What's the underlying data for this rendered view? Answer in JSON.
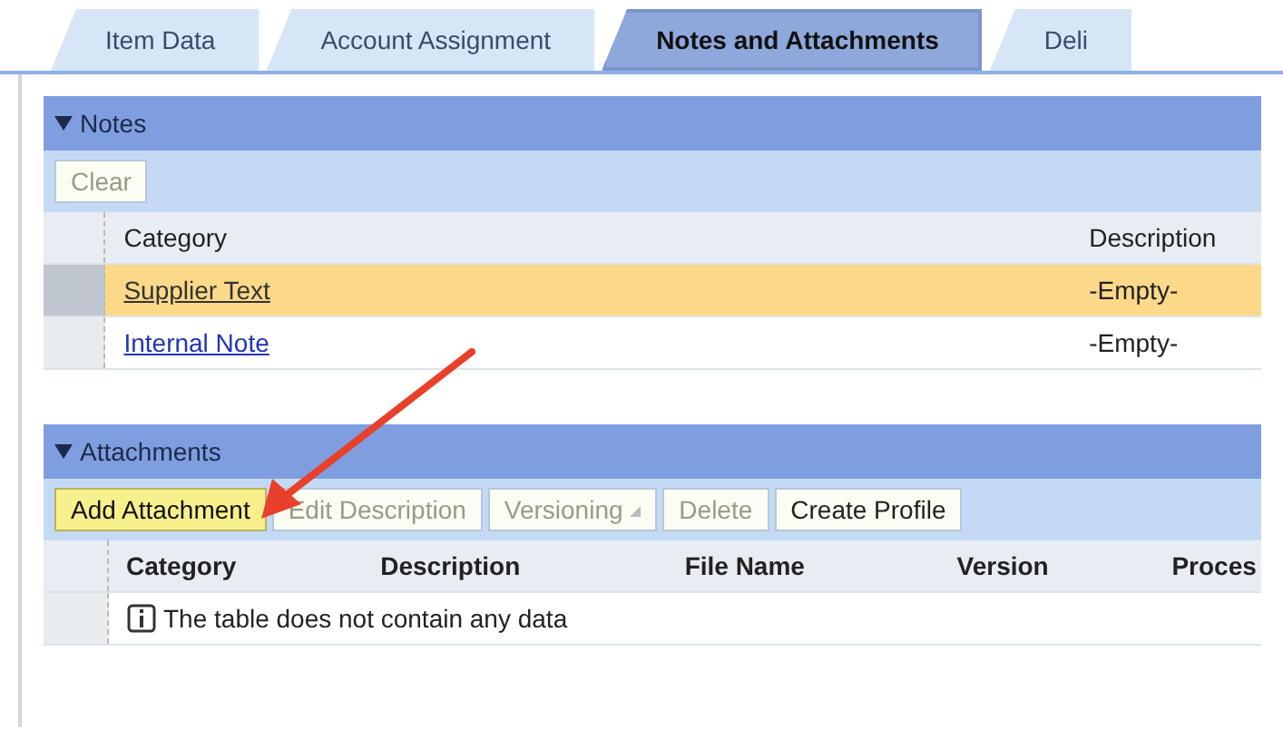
{
  "tabs": [
    {
      "label": "Item Data",
      "selected": false
    },
    {
      "label": "Account Assignment",
      "selected": false
    },
    {
      "label": "Notes and Attachments",
      "selected": true
    },
    {
      "label": "Deli",
      "selected": false
    }
  ],
  "notes": {
    "title": "Notes",
    "expanded": true,
    "toolbar": [
      {
        "label": "Clear",
        "disabled": true,
        "highlighted": false
      }
    ],
    "columns": [
      "Category",
      "Description"
    ],
    "rows": [
      {
        "category": "Supplier Text",
        "description": "-Empty-",
        "selected": true
      },
      {
        "category": "Internal Note",
        "description": "-Empty-",
        "selected": false
      }
    ]
  },
  "attachments": {
    "title": "Attachments",
    "expanded": true,
    "toolbar": [
      {
        "label": "Add Attachment",
        "disabled": false,
        "highlighted": true
      },
      {
        "label": "Edit Description",
        "disabled": true,
        "highlighted": false
      },
      {
        "label": "Versioning",
        "disabled": true,
        "highlighted": false,
        "kind": "menu"
      },
      {
        "label": "Delete",
        "disabled": true,
        "highlighted": false
      },
      {
        "label": "Create Profile",
        "disabled": false,
        "highlighted": false
      }
    ],
    "columns": [
      "Category",
      "Description",
      "File Name",
      "Version",
      "Proces"
    ],
    "empty_message": "The table does not contain any data"
  }
}
